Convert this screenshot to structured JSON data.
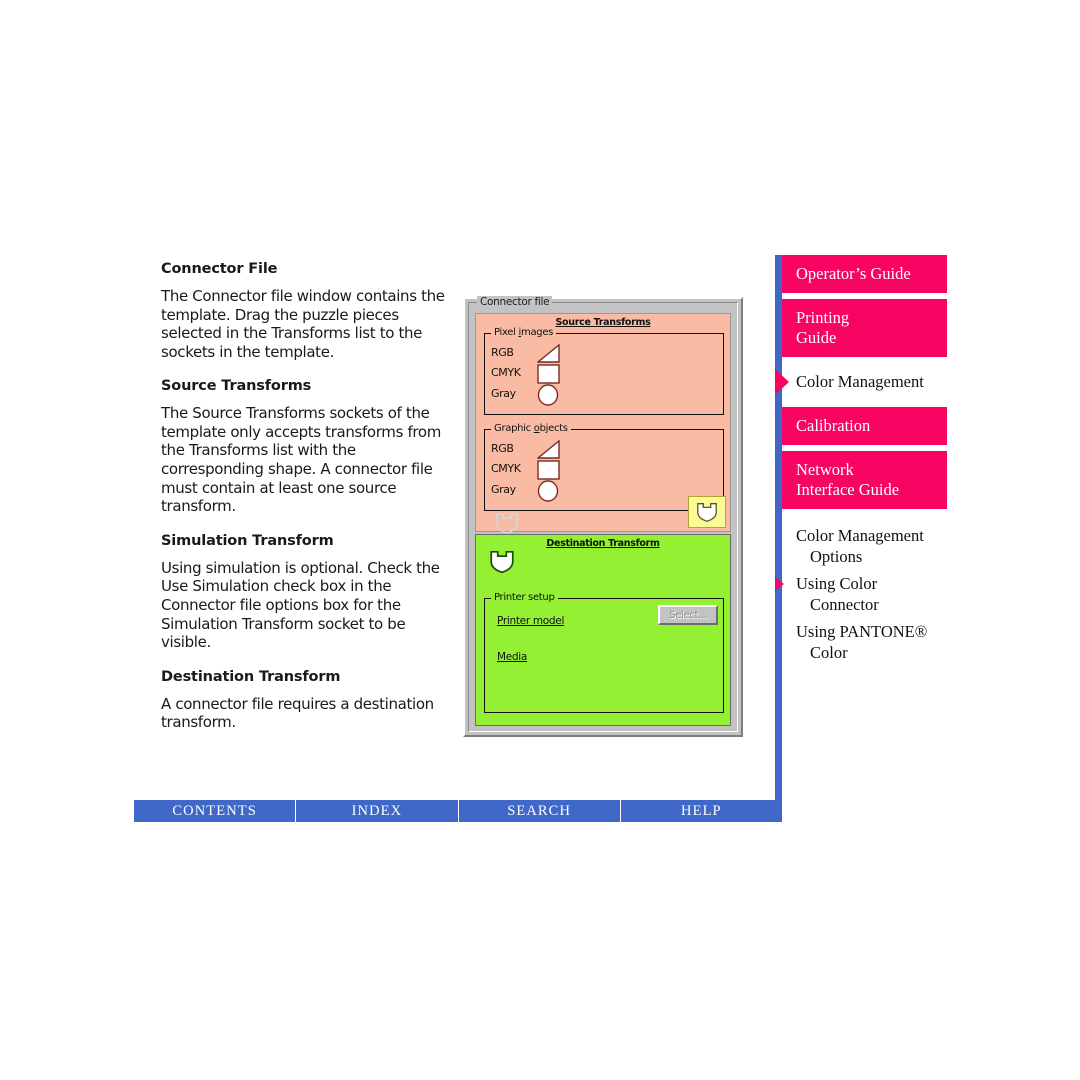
{
  "document": {
    "sections": [
      {
        "heading": "Connector File",
        "paragraph": "The Connector file window contains the template. Drag the puzzle pieces selected in the Transforms list to the sockets in the template."
      },
      {
        "heading": "Source Transforms",
        "paragraph": "The Source Transforms sockets of the template only accepts transforms from the Transforms list with the corresponding shape. A connector file must contain at least one source transform."
      },
      {
        "heading": "Simulation Transform",
        "paragraph": "Using simulation is optional. Check the Use Simulation check box in the Connector file options box for the Simulation Transform socket to be visible."
      },
      {
        "heading": "Destination Transform",
        "paragraph": "A connector file requires a destination transform."
      }
    ]
  },
  "dialog": {
    "title": "Connector file",
    "source": {
      "title": "Source Transforms",
      "groups": [
        {
          "legend": "Pixel images",
          "legend_mnemonic_index": 7,
          "rows": [
            {
              "label": "RGB",
              "shape": "triangle-socket"
            },
            {
              "label": "CMYK",
              "shape": "square-socket"
            },
            {
              "label": "Gray",
              "shape": "circle-socket"
            }
          ]
        },
        {
          "legend": "Graphic objects",
          "legend_mnemonic_index": 8,
          "rows": [
            {
              "label": "RGB",
              "shape": "triangle-socket"
            },
            {
              "label": "CMYK",
              "shape": "square-socket"
            },
            {
              "label": "Gray",
              "shape": "circle-socket"
            }
          ]
        }
      ],
      "ghost_socket_icon": "puzzle-piece-ghost-icon",
      "highlight_piece_icon": "puzzle-piece-yellow-icon"
    },
    "destination": {
      "title": "Destination Transform",
      "socket_icon": "puzzle-piece-white-icon",
      "group": {
        "legend": "Printer setup",
        "fields": [
          {
            "label": "Printer model",
            "value": ""
          },
          {
            "label": "Media",
            "value": ""
          }
        ],
        "select_button": "Select..."
      }
    }
  },
  "nav": {
    "tabs": [
      {
        "label": "Operator's Guide",
        "lines": [
          "Operator’s Guide"
        ],
        "current": false
      },
      {
        "label": "Printing Guide",
        "lines": [
          "Printing",
          "Guide"
        ],
        "current": false
      },
      {
        "label": "Color Management",
        "lines": [
          "Color Management"
        ],
        "current": true
      },
      {
        "label": "Calibration",
        "lines": [
          "Calibration"
        ],
        "current": false
      },
      {
        "label": "Network Interface Guide",
        "lines": [
          "Network",
          "Interface Guide"
        ],
        "current": false
      }
    ],
    "sub_items": [
      {
        "line1": "Color Management",
        "line2": "Options",
        "current": false
      },
      {
        "line1": "Using Color",
        "line2": "Connector",
        "current": true
      },
      {
        "line1": "Using PANTONE®",
        "line2": "Color",
        "current": false
      }
    ]
  },
  "bottom_bar": {
    "links": [
      "CONTENTS",
      "INDEX",
      "SEARCH",
      "HELP"
    ]
  },
  "colors": {
    "accent_magenta": "#F80462",
    "accent_blue": "#3F68C8",
    "source_pink": "#F9BBA4",
    "destination_green": "#93F032",
    "dialog_gray": "#C3C3C3",
    "highlight_yellow": "#FAFA96"
  }
}
